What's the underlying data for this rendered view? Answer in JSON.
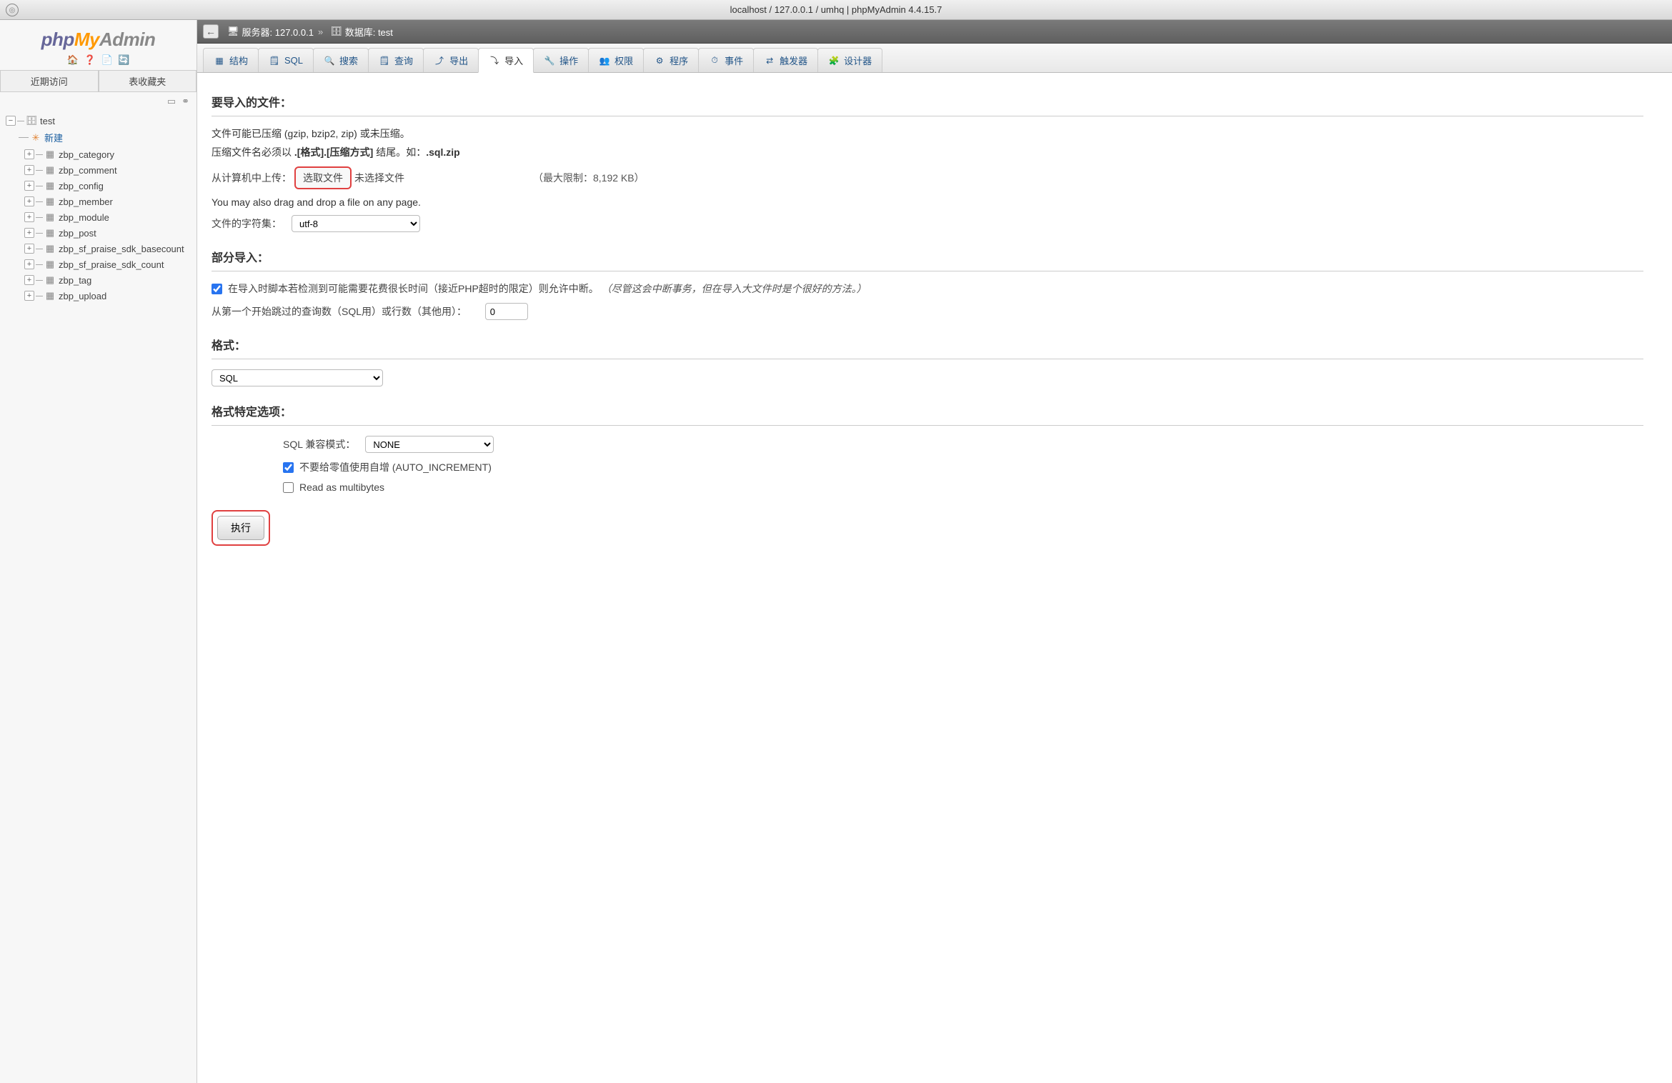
{
  "titlebar": "localhost / 127.0.0.1 / umhq | phpMyAdmin 4.4.15.7",
  "logo": {
    "php": "php",
    "my": "My",
    "admin": "Admin"
  },
  "sidebar_tabs": {
    "recent": "近期访问",
    "favorites": "表收藏夹"
  },
  "tree": {
    "db": "test",
    "new_label": "新建",
    "tables": [
      "zbp_category",
      "zbp_comment",
      "zbp_config",
      "zbp_member",
      "zbp_module",
      "zbp_post",
      "zbp_sf_praise_sdk_basecount",
      "zbp_sf_praise_sdk_count",
      "zbp_tag",
      "zbp_upload"
    ]
  },
  "breadcrumb": {
    "server_label": "服务器: 127.0.0.1",
    "db_label": "数据库: test"
  },
  "tabs": [
    {
      "id": "structure",
      "label": "结构"
    },
    {
      "id": "sql",
      "label": "SQL"
    },
    {
      "id": "search",
      "label": "搜索"
    },
    {
      "id": "query",
      "label": "查询"
    },
    {
      "id": "export",
      "label": "导出"
    },
    {
      "id": "import",
      "label": "导入"
    },
    {
      "id": "operations",
      "label": "操作"
    },
    {
      "id": "privileges",
      "label": "权限"
    },
    {
      "id": "routines",
      "label": "程序"
    },
    {
      "id": "events",
      "label": "事件"
    },
    {
      "id": "triggers",
      "label": "触发器"
    },
    {
      "id": "designer",
      "label": "设计器"
    }
  ],
  "import": {
    "file_section": "要导入的文件：",
    "compress_info": "文件可能已压缩 (gzip, bzip2, zip) 或未压缩。",
    "filename_info_pre": "压缩文件名必须以 ",
    "filename_info_mid": ".[格式].[压缩方式]",
    "filename_info_post": " 结尾。如：",
    "filename_example": ".sql.zip",
    "upload_label": "从计算机中上传：",
    "choose_file": "选取文件",
    "no_file": "未选择文件",
    "limit": "（最大限制：8,192 KB）",
    "dragdrop": "You may also drag and drop a file on any page.",
    "charset_label": "文件的字符集：",
    "charset_value": "utf-8",
    "partial_section": "部分导入：",
    "partial_check": "在导入时脚本若检测到可能需要花费很长时间（接近PHP超时的限定）则允许中断。",
    "partial_note": "（尽管这会中断事务，但在导入大文件时是个很好的方法。）",
    "skip_label": "从第一个开始跳过的查询数（SQL用）或行数（其他用）：",
    "skip_value": "0",
    "format_section": "格式：",
    "format_value": "SQL",
    "format_options_section": "格式特定选项：",
    "compat_label": "SQL 兼容模式：",
    "compat_value": "NONE",
    "autoinc_label": "不要给零值使用自增 (AUTO_INCREMENT)",
    "multibytes_label": "Read as multibytes",
    "execute": "执行"
  }
}
